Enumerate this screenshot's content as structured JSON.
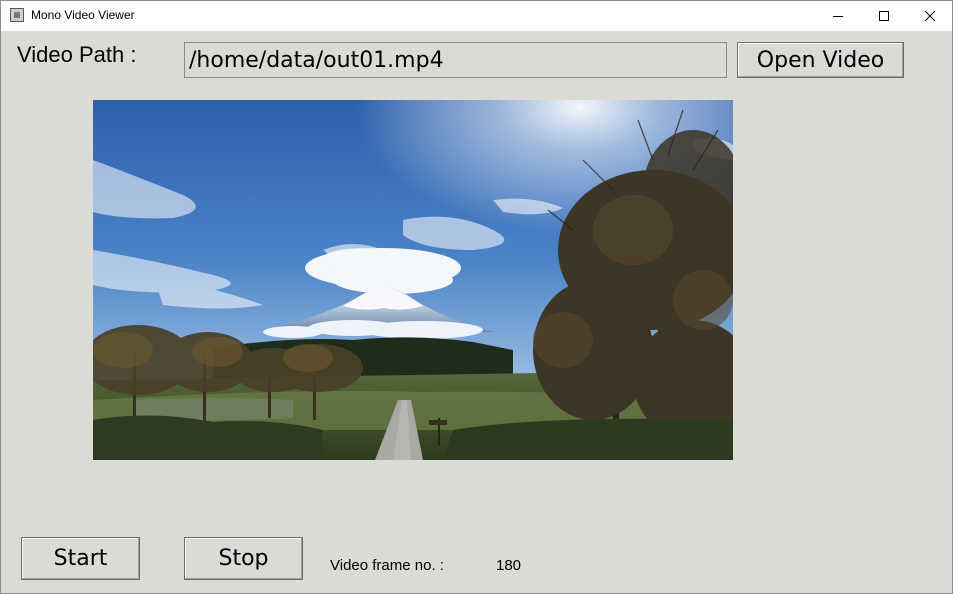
{
  "window": {
    "title": "Mono Video Viewer",
    "app_icon": "app-window-icon",
    "controls": {
      "minimize_icon": "minimize-icon",
      "maximize_icon": "maximize-icon",
      "close_icon": "close-icon"
    }
  },
  "path_row": {
    "label": "Video Path :",
    "path_value": "/home/data/out01.mp4",
    "open_button_label": "Open Video"
  },
  "video": {
    "content": "Mountain landscape frame"
  },
  "controls": {
    "start_label": "Start",
    "stop_label": "Stop",
    "frame_label": "Video frame no. :",
    "frame_value": "180"
  },
  "colors": {
    "window_bg": "#dcdad5",
    "titlebar_bg": "#ffffff",
    "sky_top": "#2f62ad",
    "sky_bottom": "#a9c7e6",
    "snow": "#f3f5f8"
  }
}
